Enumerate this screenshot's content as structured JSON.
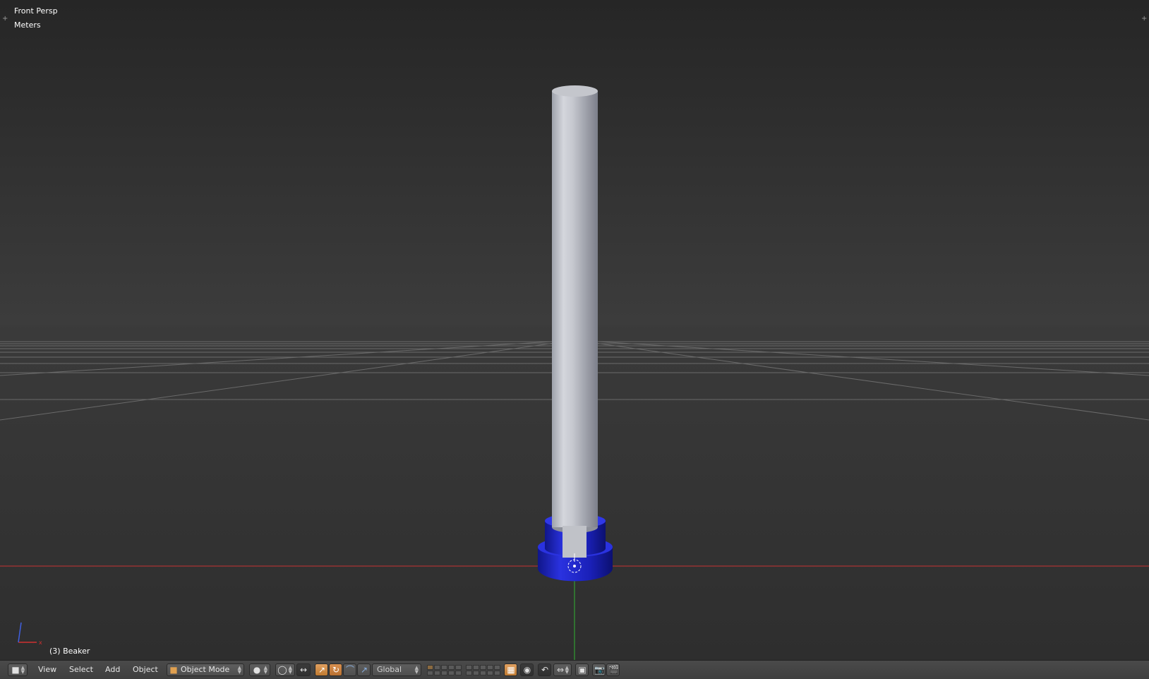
{
  "viewport": {
    "view_label": "Front Persp",
    "units_label": "Meters",
    "object_label": "(3) Beaker"
  },
  "header": {
    "editor_type_icon": "3d-view-icon",
    "menus": [
      "View",
      "Select",
      "Add",
      "Object"
    ],
    "mode": {
      "icon": "object-cube-icon",
      "label": "Object Mode"
    },
    "shading_icon": "solid-sphere-icon",
    "pivot_icon": "pivot-point-icon",
    "manipulator_icon": "manipulator-toggle-icon",
    "transform_orientation": "Global",
    "icons": [
      "translate-icon",
      "rotate-icon",
      "scale-icon",
      "layer-icon",
      "proportional-edit-icon",
      "snap-icon",
      "snap-element-icon",
      "render-still-icon",
      "render-animation-icon"
    ]
  },
  "colors": {
    "beaker_body": "#b8bcc6",
    "beaker_base": "#1e24c8",
    "x_axis": "#c83232",
    "y_axis": "#32b432",
    "grid": "#6a6a6a",
    "accent_active": "#d08a40"
  }
}
